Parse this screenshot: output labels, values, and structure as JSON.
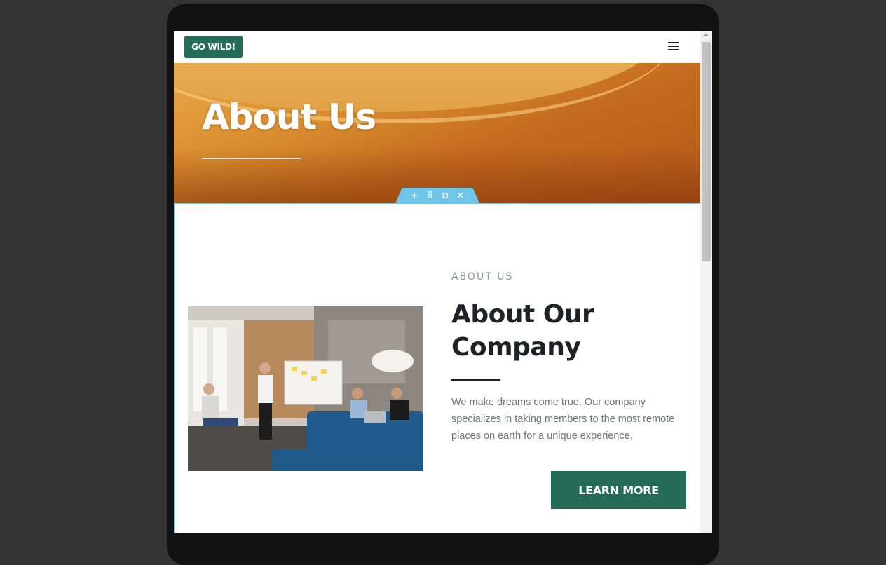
{
  "colors": {
    "brand_green": "#246c58",
    "page_background": "#333333",
    "section_border": "#7cc8e0",
    "toolbar": "#6fc6e9"
  },
  "header": {
    "logo_label": "GO WILD!",
    "menu_icon": "hamburger-icon"
  },
  "hero": {
    "title": "About Us"
  },
  "editor_toolbar": {
    "add": "+",
    "move": "⠿",
    "duplicate": "⧉",
    "remove": "✕"
  },
  "about": {
    "eyebrow": "ABOUT US",
    "heading": "About Our Company",
    "body": "We make dreams come true. Our company specializes in taking members to the most remote places on earth for a unique experience.",
    "cta_label": "LEARN MORE",
    "image": "team-meeting-photo"
  }
}
